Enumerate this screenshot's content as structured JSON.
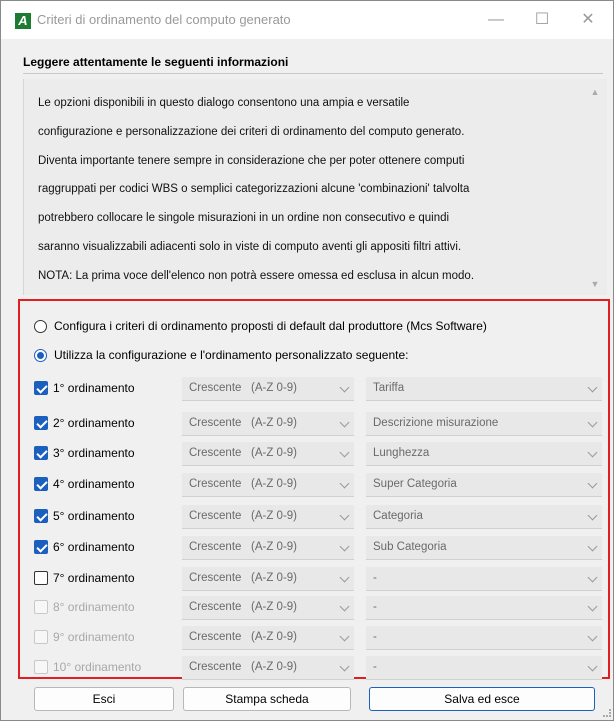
{
  "window": {
    "title": "Criteri di ordinamento del computo generato",
    "minimize": "—",
    "maximize": "☐",
    "close": "✕",
    "icon_letter": "A"
  },
  "heading": "Leggere attentamente le seguenti informazioni",
  "info_lines": [
    "Le opzioni disponibili in questo dialogo consentono una ampia e versatile",
    "configurazione e personalizzazione dei criteri di ordinamento del computo generato.",
    "Diventa importante tenere sempre in considerazione che per poter ottenere computi",
    "raggruppati per codici WBS o semplici categorizzazioni alcune 'combinazioni' talvolta",
    "potrebbero collocare le singole misurazioni in un ordine non consecutivo e quindi",
    "saranno visualizzabili adiacenti solo in viste di computo aventi gli appositi filtri attivi.",
    "NOTA: La prima voce dell'elenco non potrà essere omessa ed esclusa in alcun modo."
  ],
  "options": {
    "default_label": "Configura i criteri di ordinamento proposti di default dal produttore (Mcs Software)",
    "default_selected": false,
    "custom_label": "Utilizza la configurazione e l'ordinamento personalizzato seguente:",
    "custom_selected": true
  },
  "orderings": [
    {
      "label": "1° ordinamento",
      "checked": true,
      "enabled": true,
      "direction": "Crescente   (A-Z 0-9)",
      "field": "Tariffa"
    },
    {
      "label": "2° ordinamento",
      "checked": true,
      "enabled": true,
      "direction": "Crescente   (A-Z 0-9)",
      "field": "Descrizione misurazione"
    },
    {
      "label": "3° ordinamento",
      "checked": true,
      "enabled": true,
      "direction": "Crescente   (A-Z 0-9)",
      "field": "Lunghezza"
    },
    {
      "label": "4° ordinamento",
      "checked": true,
      "enabled": true,
      "direction": "Crescente   (A-Z 0-9)",
      "field": "Super Categoria"
    },
    {
      "label": "5° ordinamento",
      "checked": true,
      "enabled": true,
      "direction": "Crescente   (A-Z 0-9)",
      "field": "Categoria"
    },
    {
      "label": "6° ordinamento",
      "checked": true,
      "enabled": true,
      "direction": "Crescente   (A-Z 0-9)",
      "field": "Sub Categoria"
    },
    {
      "label": "7° ordinamento",
      "checked": false,
      "enabled": true,
      "direction": "Crescente   (A-Z 0-9)",
      "field": "-"
    },
    {
      "label": "8° ordinamento",
      "checked": false,
      "enabled": false,
      "direction": "Crescente   (A-Z 0-9)",
      "field": "-"
    },
    {
      "label": "9° ordinamento",
      "checked": false,
      "enabled": false,
      "direction": "Crescente   (A-Z 0-9)",
      "field": "-"
    },
    {
      "label": "10° ordinamento",
      "checked": false,
      "enabled": false,
      "direction": "Crescente   (A-Z 0-9)",
      "field": "-"
    }
  ],
  "buttons": {
    "esci": "Esci",
    "stampa": "Stampa scheda",
    "salva": "Salva ed esce"
  },
  "colors": {
    "accent": "#1b5fbf",
    "highlight_border": "#e02020",
    "app_icon": "#1e7b34"
  }
}
